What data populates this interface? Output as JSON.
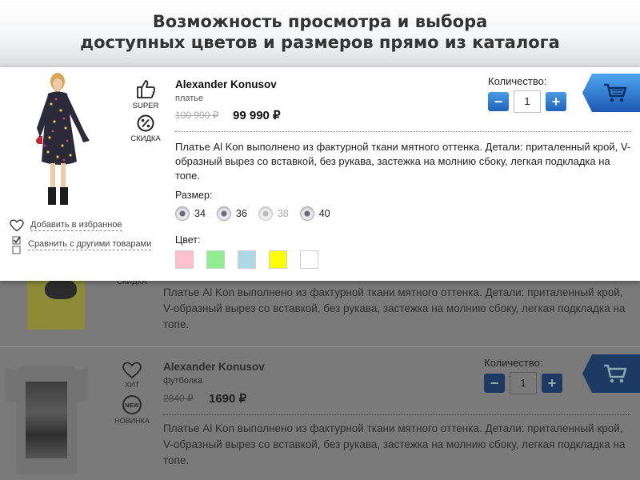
{
  "header": {
    "title_line1": "Возможность просмотра и выбора",
    "title_line2": "доступных цветов и размеров прямо из каталога"
  },
  "popup": {
    "badges": [
      {
        "label": "SUPER",
        "icon": "thumbs-up-icon"
      },
      {
        "label": "СКИДКА",
        "icon": "percent-icon"
      }
    ],
    "brand": "Alexander Konusov",
    "type": "платье",
    "old_price": "100 990 ₽",
    "price": "99 990 ₽",
    "quantity_label": "Количество:",
    "quantity_value": "1",
    "minus": "−",
    "plus": "+",
    "description": "Платье Al Kon выполнено из фактурной ткани мятного оттенка. Детали: приталенный крой, V-образный вырез со вставкой, без рукава, застежка на молнию сбоку, легкая подкладка на топе.",
    "size_label": "Размер:",
    "sizes": [
      {
        "label": "34",
        "available": true
      },
      {
        "label": "36",
        "available": true
      },
      {
        "label": "38",
        "available": false
      },
      {
        "label": "40",
        "available": true
      }
    ],
    "color_label": "Цвет:",
    "colors": [
      "#ffc0cb",
      "#90ee90",
      "#add8e6",
      "#ffff00",
      "#ffffff"
    ],
    "favorite_link": "Добавить в избранное",
    "compare_link": "Сравнить с другими товарами"
  },
  "background": {
    "item1": {
      "badge": "СКИДКА",
      "description": "Платье Al Kon выполнено из фактурной ткани мятного оттенка. Детали: приталенный крой, V-образный вырез со вставкой, без рукава, застежка на молнию сбоку, легкая подкладка на топе."
    },
    "item2": {
      "badges": [
        {
          "label": "ХИТ",
          "icon": "heart-icon"
        },
        {
          "label": "НОВИНКА",
          "icon": "new-badge-icon"
        }
      ],
      "brand": "Alexander Konusov",
      "type": "футболка",
      "old_price": "2840 ₽",
      "price": "1690 ₽",
      "quantity_label": "Количество:",
      "quantity_value": "1",
      "minus": "−",
      "plus": "+",
      "new_text": "NEW",
      "description": "Платье Al Kon выполнено из фактурной ткани мятного оттенка. Детали: приталенный крой, V-образный вырез со вставкой, без рукава, застежка на молнию сбоку, легкая подкладка на топе."
    }
  },
  "colors": {
    "accent_blue": "#1f62b8",
    "overlay_gray": "#7a7a7a"
  }
}
